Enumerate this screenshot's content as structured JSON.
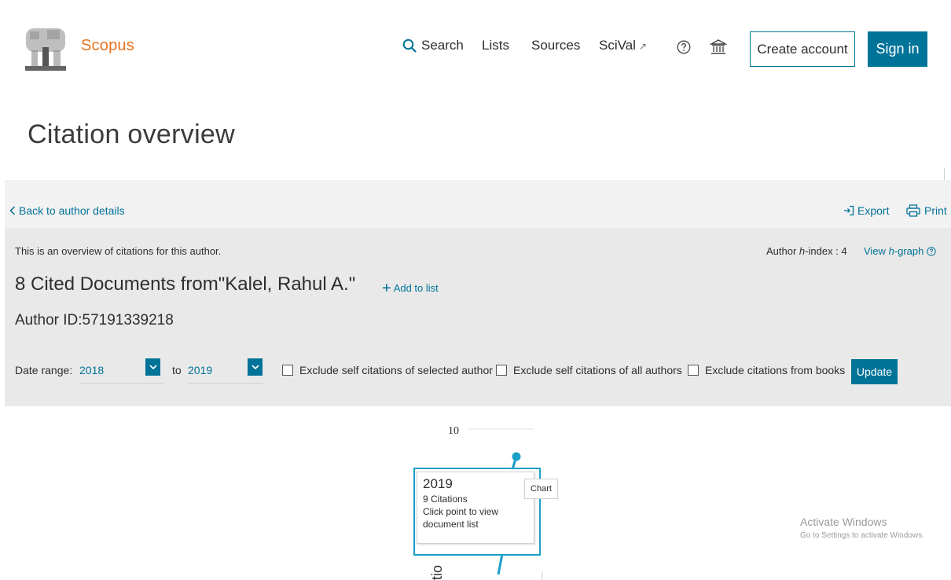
{
  "header": {
    "brand": "Scopus",
    "nav": {
      "search": "Search",
      "lists": "Lists",
      "sources": "Sources",
      "scival": "SciVal",
      "scival_ext": "↗"
    },
    "create_account": "Create account",
    "sign_in": "Sign in"
  },
  "page_title": "Citation overview",
  "toolbar": {
    "back": "Back to author details",
    "export": "Export",
    "print": "Print"
  },
  "overview": {
    "intro": "This is an overview of citations for this author.",
    "hindex_prefix": "Author ",
    "hindex_h": "h",
    "hindex_suffix": "-index : 4",
    "view_hgraph_prefix": "View ",
    "view_hgraph_h": "h",
    "view_hgraph_suffix": "-graph",
    "title": "8 Cited Documents from\"Kalel, Rahul A.\"",
    "add_to_list": "Add to list",
    "author_id": "Author ID:57191339218"
  },
  "filters": {
    "date_range_label": "Date range:",
    "from_year": "2018",
    "to_label": "to",
    "to_year": "2019",
    "exclude_selected": "Exclude self citations of selected author",
    "exclude_all": "Exclude self citations of all authors",
    "exclude_books": "Exclude citations from books",
    "update": "Update"
  },
  "chart_data": {
    "type": "line",
    "x": [
      "2019"
    ],
    "y_ticks": [
      "10"
    ],
    "axis_label_fragment": "tio",
    "series": [
      {
        "values": [
          9
        ]
      }
    ],
    "color": "#1a9fc9",
    "tooltip": {
      "year": "2019",
      "citations": "9 Citations",
      "hint": "Click point to view document list"
    },
    "badge": "Chart"
  },
  "watermark": {
    "line1": "Activate Windows",
    "line2": "Go to Settings to activate Windows."
  },
  "colors": {
    "brand_orange": "#e9711c",
    "accent": "#007398"
  }
}
